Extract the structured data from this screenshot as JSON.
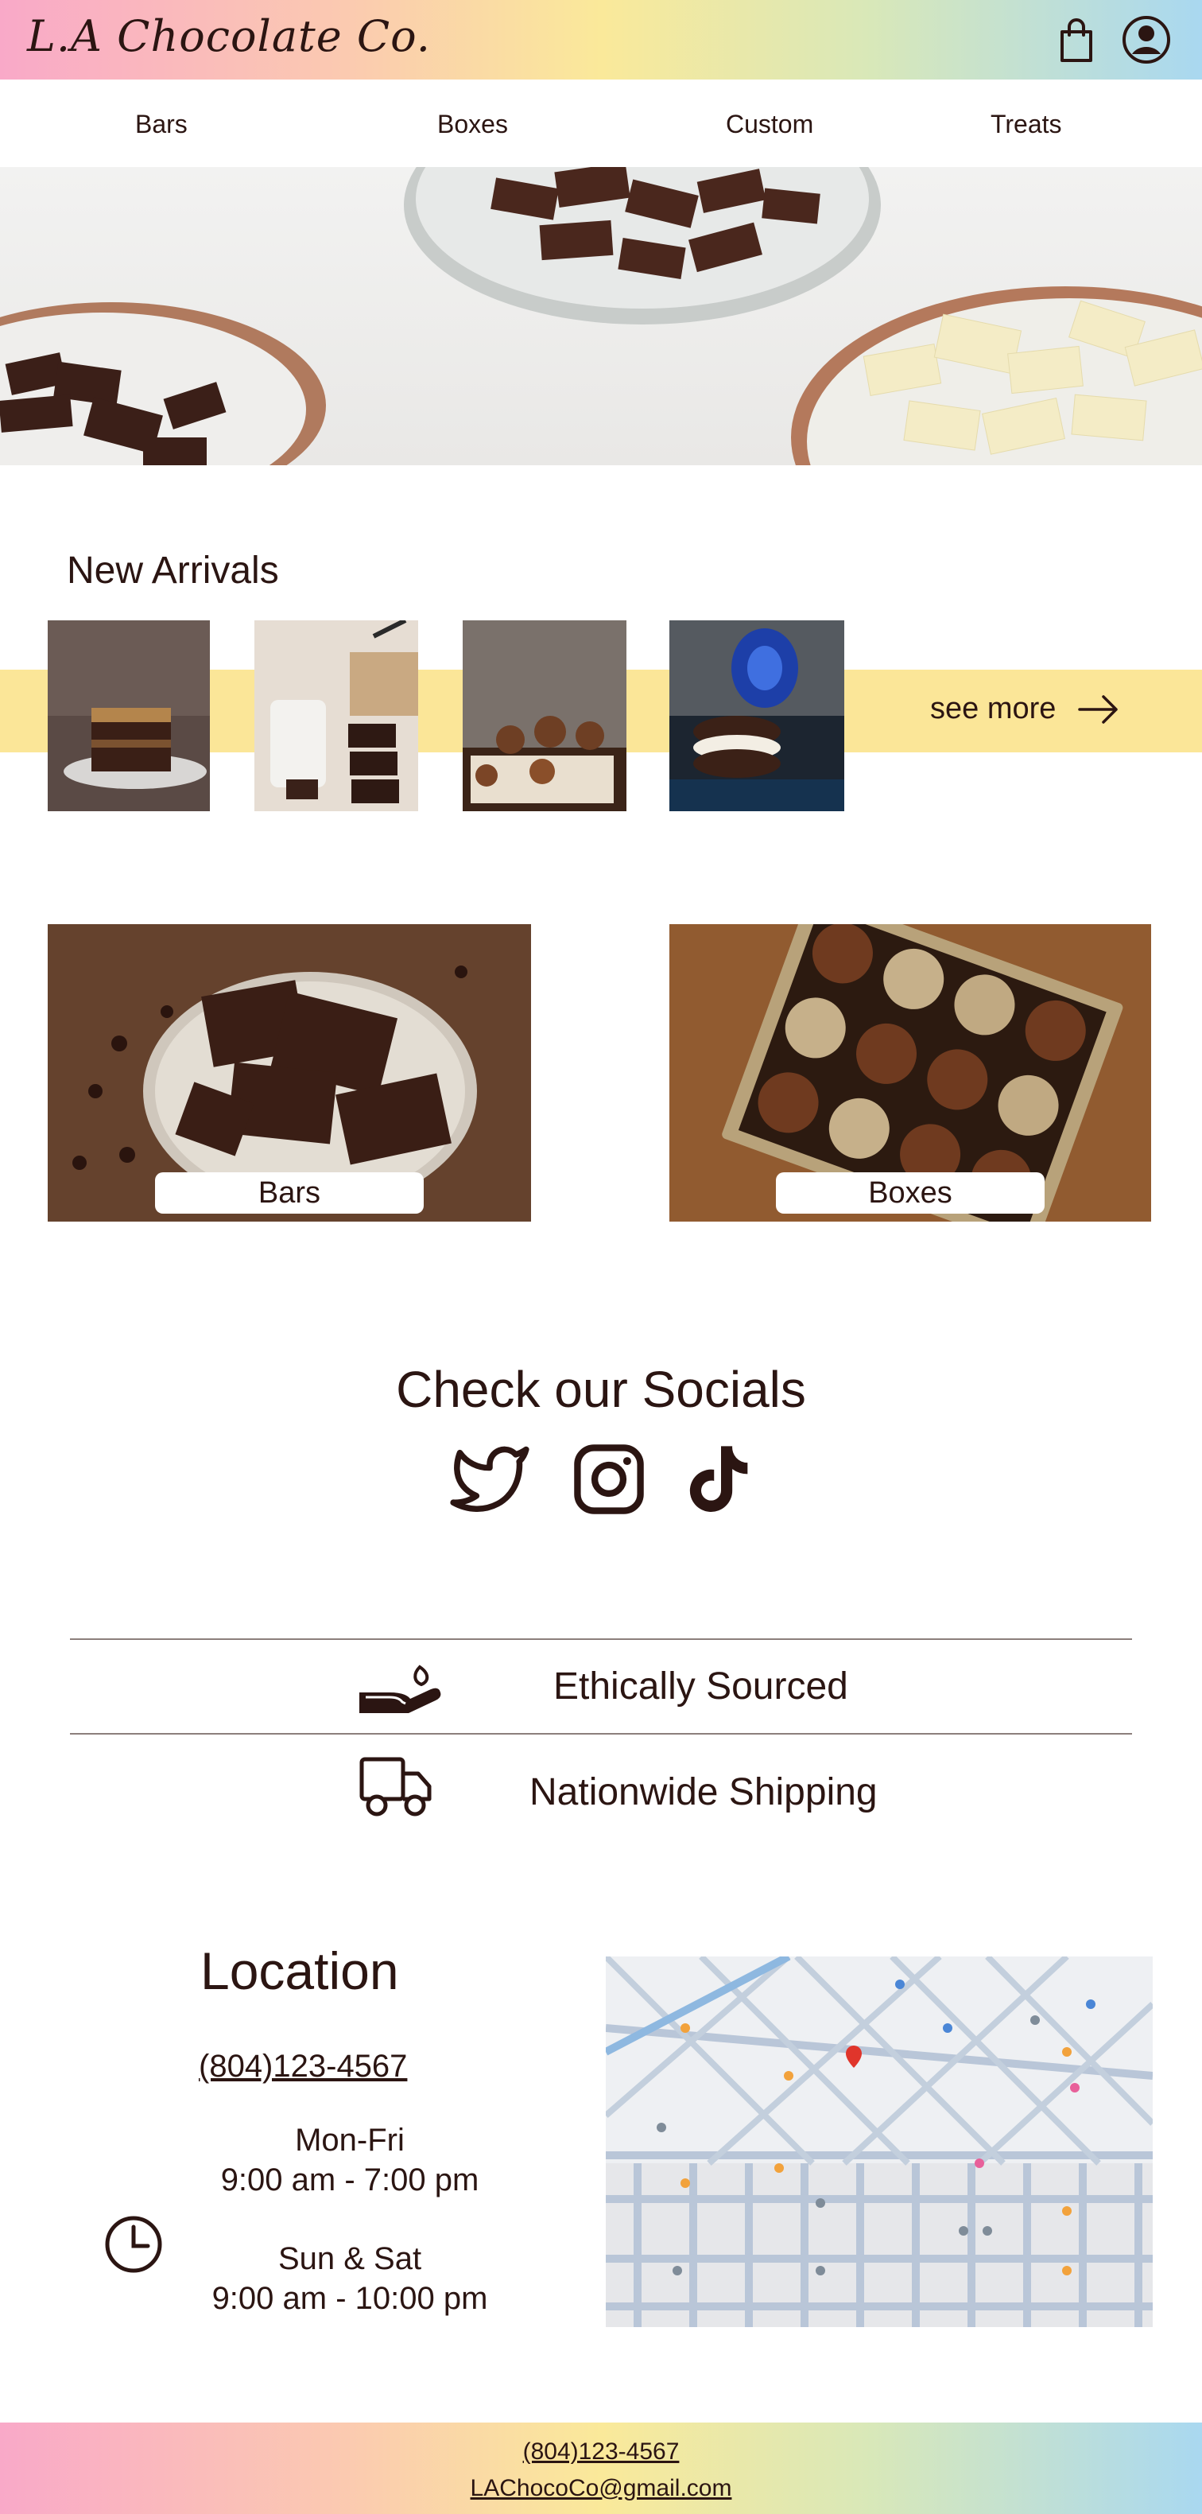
{
  "header": {
    "logo": "L.A Chocolate Co.",
    "icons": [
      "shopping-bag-icon",
      "user-account-icon"
    ]
  },
  "nav": {
    "items": [
      {
        "label": "Bars"
      },
      {
        "label": "Boxes"
      },
      {
        "label": "Custom"
      },
      {
        "label": "Treats"
      }
    ]
  },
  "new_arrivals": {
    "title": "New Arrivals",
    "see_more": "see more"
  },
  "categories": [
    {
      "label": "Bars"
    },
    {
      "label": "Boxes"
    }
  ],
  "socials": {
    "title": "Check our Socials",
    "icons": [
      "twitter-icon",
      "instagram-icon",
      "tiktok-icon"
    ]
  },
  "features": [
    {
      "label": "Ethically Sourced",
      "icon": "hand-giving-icon"
    },
    {
      "label": "Nationwide Shipping",
      "icon": "delivery-truck-icon"
    }
  ],
  "location": {
    "title": "Location",
    "phone": "(804)123-4567",
    "hours": [
      {
        "days": "Mon-Fri",
        "time": "9:00 am - 7:00 pm"
      },
      {
        "days": "Sun & Sat",
        "time": "9:00 am - 10:00 pm"
      }
    ]
  },
  "footer": {
    "phone": "(804)123-4567",
    "email": "LAChocoCo@gmail.com"
  },
  "colors": {
    "text": "#2b1512",
    "band": "#fbe698",
    "gradient_left": "#f9a9c8",
    "gradient_mid": "#fae99a",
    "gradient_right": "#a9d8f0"
  }
}
